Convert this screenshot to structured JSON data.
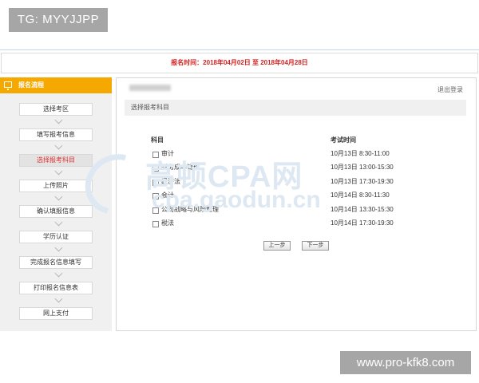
{
  "overlay": {
    "tg_label": "TG: MYYJJPP",
    "url_label": "www.pro-kfk8.com"
  },
  "registration": {
    "period_text": "报名时间：2018年04月02日 至 2018年04月28日"
  },
  "sidebar": {
    "title": "报名流程",
    "icon": "monitor-icon",
    "steps": [
      {
        "label": "选择考区",
        "active": false
      },
      {
        "label": "填写报考信息",
        "active": false
      },
      {
        "label": "选择报考科目",
        "active": true
      },
      {
        "label": "上传照片",
        "active": false
      },
      {
        "label": "确认填报信息",
        "active": false
      },
      {
        "label": "学历认证",
        "active": false
      },
      {
        "label": "完成报名信息填写",
        "active": false
      },
      {
        "label": "打印报名信息表",
        "active": false
      },
      {
        "label": "网上支付",
        "active": false
      }
    ]
  },
  "main": {
    "logout_label": "退出登录",
    "section_title": "选择报考科目",
    "table": {
      "headers": [
        "科目",
        "考试时间"
      ],
      "rows": [
        {
          "subject": "审计",
          "time": "10月13日 8:30-11:00"
        },
        {
          "subject": "财务成本管理",
          "time": "10月13日 13:00-15:30"
        },
        {
          "subject": "经济法",
          "time": "10月13日 17:30-19:30"
        },
        {
          "subject": "会计",
          "time": "10月14日 8:30-11:30"
        },
        {
          "subject": "公司战略与风险管理",
          "time": "10月14日 13:30-15:30"
        },
        {
          "subject": "税法",
          "time": "10月14日 17:30-19:30"
        }
      ]
    },
    "prev_label": "上一步",
    "next_label": "下一步"
  },
  "watermark": {
    "line1": "高顿CPA网",
    "line2": "cpa.gaodun.cn"
  },
  "colors": {
    "accent": "#f5a800",
    "alert": "#d32020"
  }
}
